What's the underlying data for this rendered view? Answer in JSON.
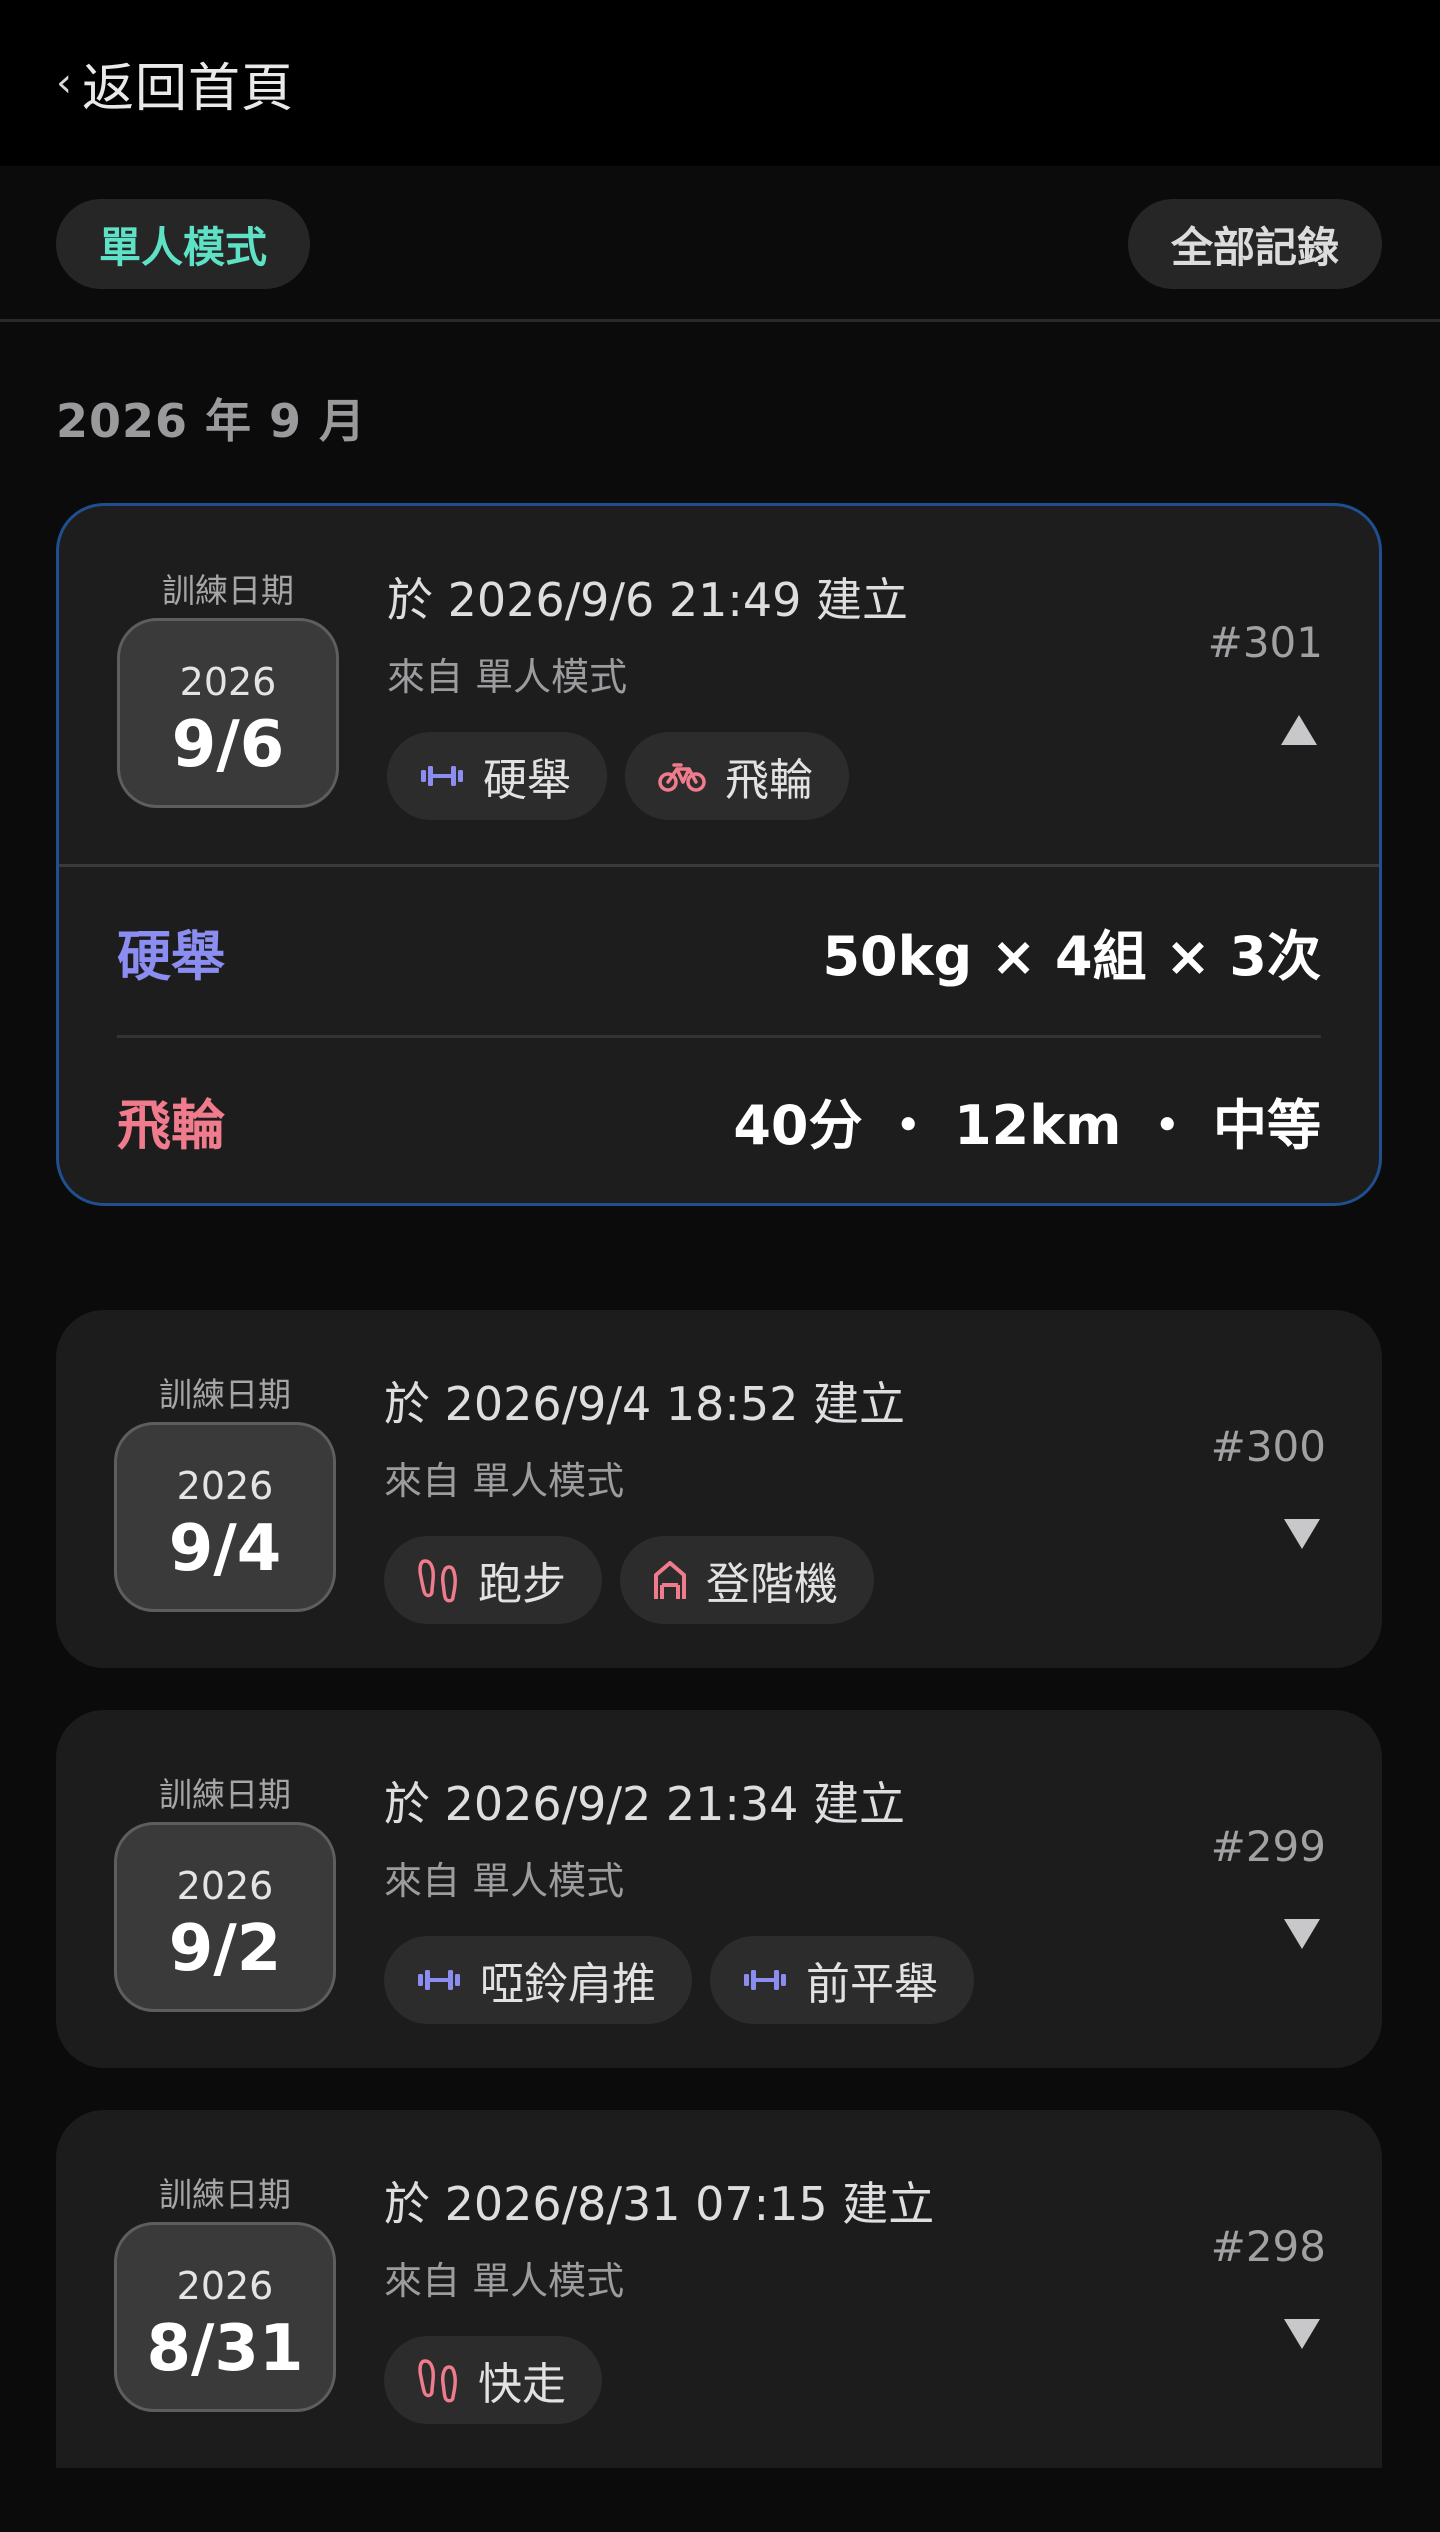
{
  "header": {
    "back_label": "返回首頁"
  },
  "modes": {
    "single": "單人模式",
    "all_records": "全部記錄"
  },
  "month_heading": "2026 年 9 月",
  "colors": {
    "accent": "#5ee1c4",
    "strength": "#8b8ef0",
    "cardio": "#ef7b8c",
    "expanded_border": "#1f4f8f"
  },
  "records": [
    {
      "date_caption": "訓練日期",
      "year": "2026",
      "day": "9/6",
      "created": "於 2026/9/6 21:49 建立",
      "source": "來自 單人模式",
      "id": "#301",
      "expanded": true,
      "tags": [
        {
          "icon": "dumbbell-icon",
          "label": "硬舉"
        },
        {
          "icon": "bike-icon",
          "label": "飛輪"
        }
      ],
      "details": [
        {
          "name": "硬舉",
          "value": "50kg × 4組 × 3次",
          "kind": "strength"
        },
        {
          "name": "飛輪",
          "value": "40分 ・ 12km ・ 中等",
          "kind": "cardio"
        }
      ]
    },
    {
      "date_caption": "訓練日期",
      "year": "2026",
      "day": "9/4",
      "created": "於 2026/9/4 18:52 建立",
      "source": "來自 單人模式",
      "id": "#300",
      "expanded": false,
      "tags": [
        {
          "icon": "footprints-icon",
          "label": "跑步"
        },
        {
          "icon": "stairs-icon",
          "label": "登階機"
        }
      ]
    },
    {
      "date_caption": "訓練日期",
      "year": "2026",
      "day": "9/2",
      "created": "於 2026/9/2 21:34 建立",
      "source": "來自 單人模式",
      "id": "#299",
      "expanded": false,
      "tags": [
        {
          "icon": "dumbbell-icon",
          "label": "啞鈴肩推"
        },
        {
          "icon": "dumbbell-icon",
          "label": "前平舉"
        }
      ]
    },
    {
      "date_caption": "訓練日期",
      "year": "2026",
      "day": "8/31",
      "created": "於 2026/8/31 07:15 建立",
      "source": "來自 單人模式",
      "id": "#298",
      "expanded": false,
      "tags": [
        {
          "icon": "footprints-icon",
          "label": "快走"
        }
      ]
    }
  ]
}
